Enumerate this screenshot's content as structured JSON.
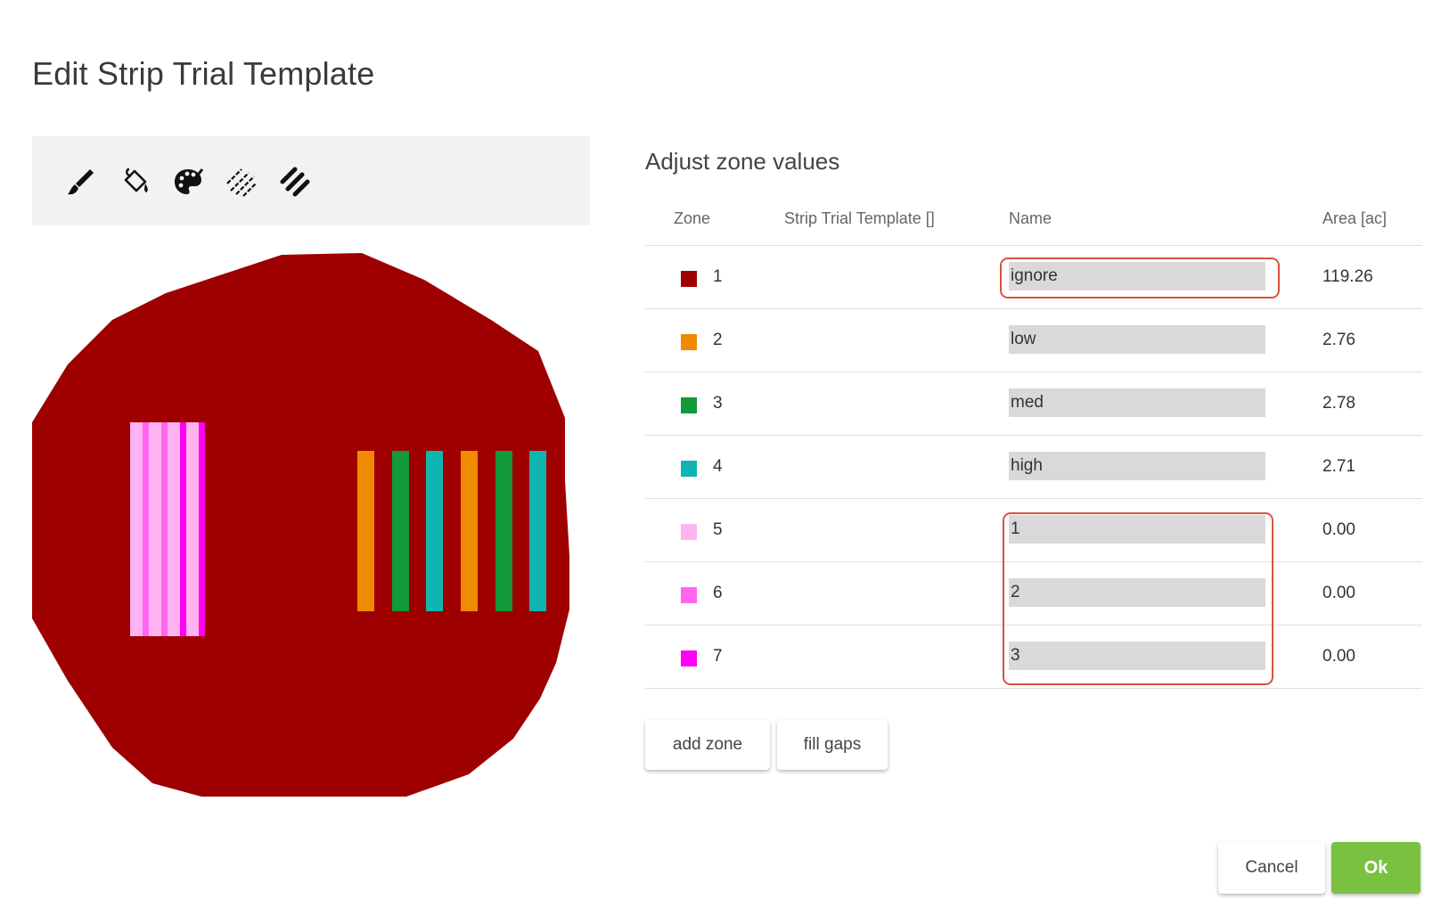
{
  "dialog": {
    "title": "Edit Strip Trial Template"
  },
  "toolbar": {
    "tools": [
      {
        "icon": "brush-icon"
      },
      {
        "icon": "paint-bucket-icon"
      },
      {
        "icon": "palette-icon"
      },
      {
        "icon": "diagonal-lines-icon"
      },
      {
        "icon": "diagonal-strips-icon"
      }
    ]
  },
  "zones_panel": {
    "title": "Adjust zone values",
    "headers": {
      "zone": "Zone",
      "template": "Strip Trial Template []",
      "name": "Name",
      "area": "Area [ac]"
    },
    "rows": [
      {
        "zone": "1",
        "color": "#9e0000",
        "name": "ignore",
        "area": "119.26"
      },
      {
        "zone": "2",
        "color": "#f08a00",
        "name": "low",
        "area": "2.76"
      },
      {
        "zone": "3",
        "color": "#11993a",
        "name": "med",
        "area": "2.78"
      },
      {
        "zone": "4",
        "color": "#0fb5b0",
        "name": "high",
        "area": "2.71"
      },
      {
        "zone": "5",
        "color": "#ffb3f2",
        "name": "1",
        "area": "0.00"
      },
      {
        "zone": "6",
        "color": "#ff66ee",
        "name": "2",
        "area": "0.00"
      },
      {
        "zone": "7",
        "color": "#ff00f0",
        "name": "3",
        "area": "0.00"
      }
    ]
  },
  "buttons": {
    "add_zone": "add zone",
    "fill_gaps": "fill gaps",
    "cancel": "Cancel",
    "ok": "Ok"
  },
  "colors": {
    "field": "#9e0000",
    "highlight": "#d9533f",
    "ok": "#7ac142"
  }
}
